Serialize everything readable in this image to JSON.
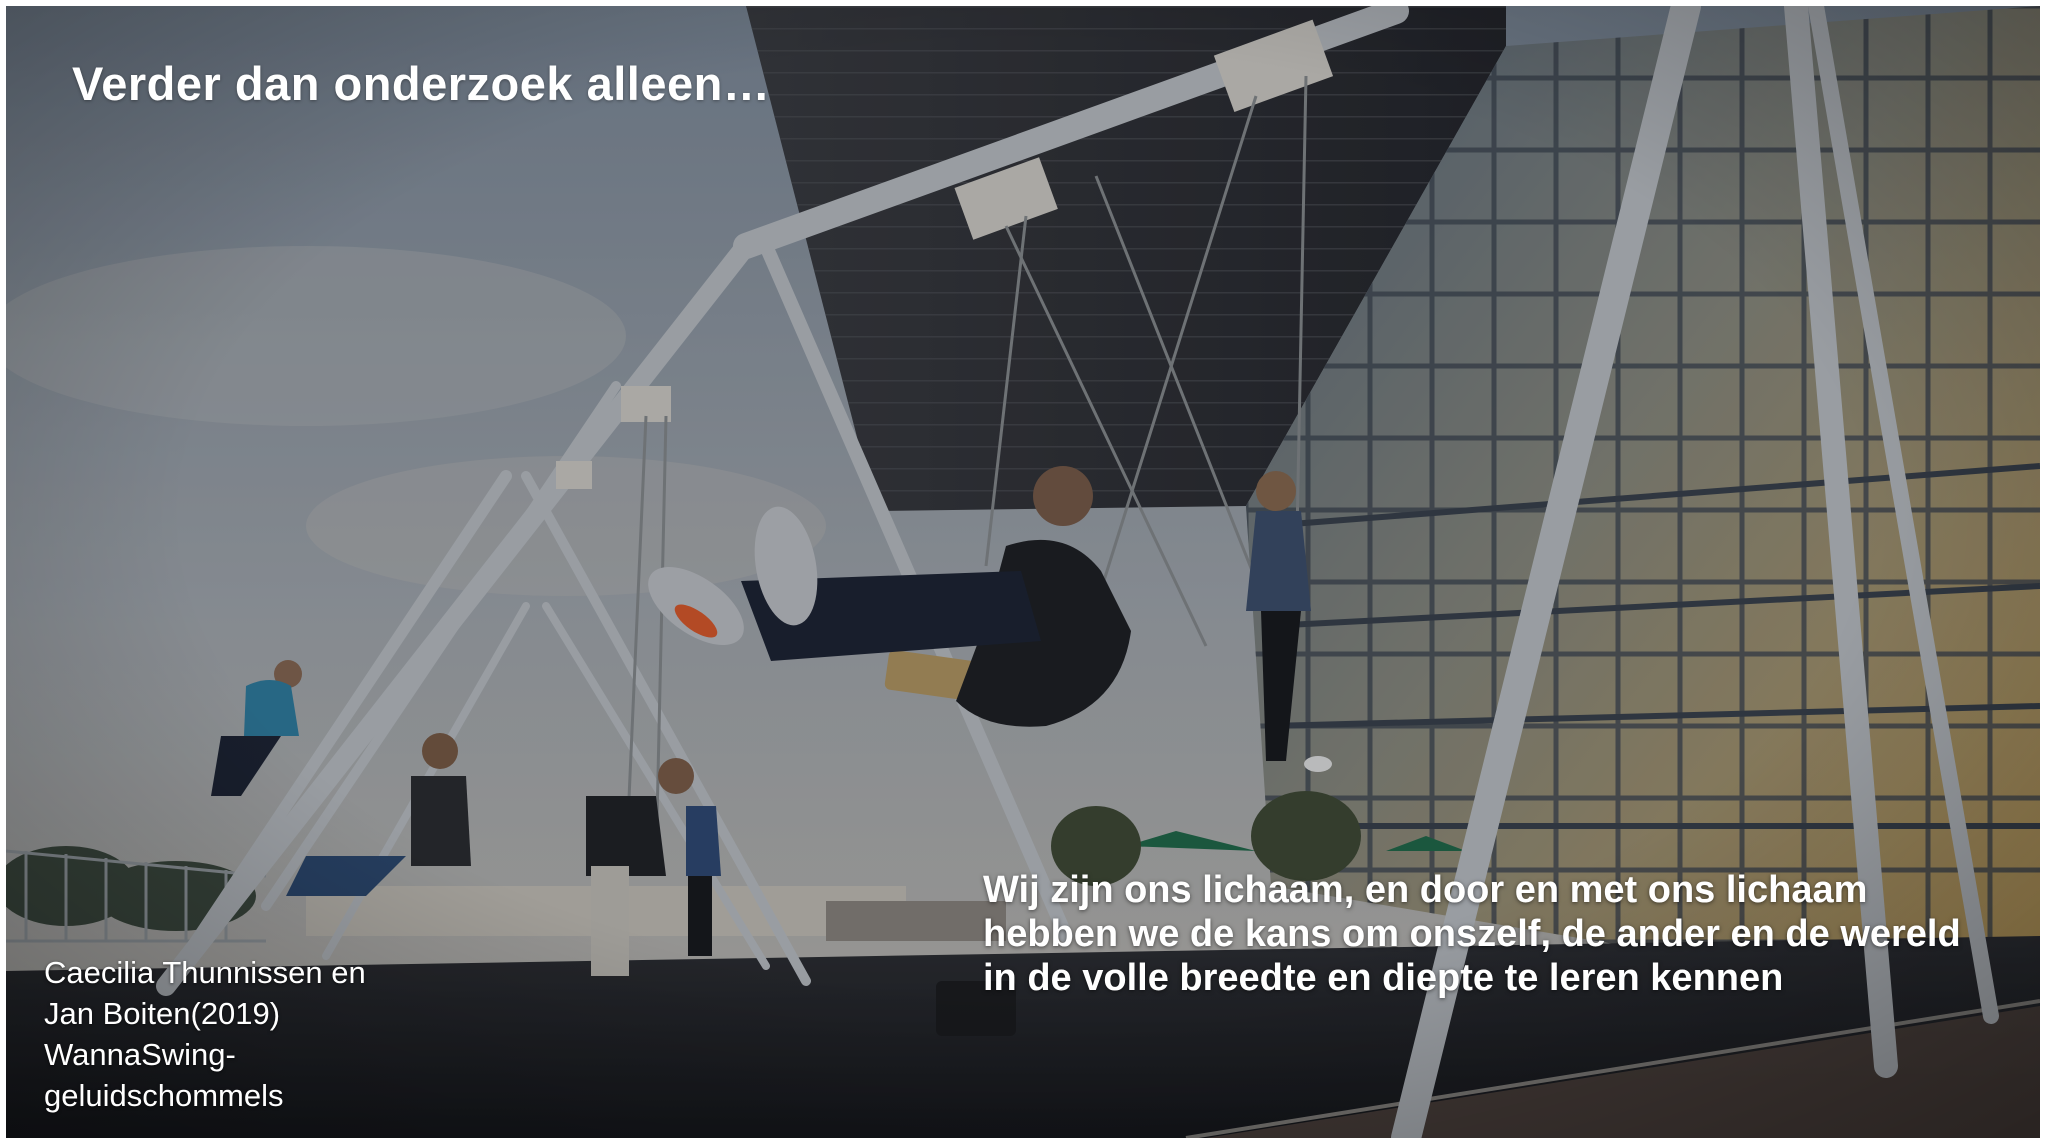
{
  "slide": {
    "title": "Verder dan onderzoek alleen…",
    "photo_credit": [
      "Caecilia Thunnissen en",
      "Jan Boiten(2019)",
      "WannaSwing-",
      "geluidschommels"
    ],
    "quote": "Wij zijn ons lichaam, en door en met ons lichaam hebben we de kans om onszelf, de ander en de wereld in de volle breedte en diepte te leren kennen"
  },
  "colors": {
    "title_text": "#ffffff",
    "sky_top": "#8a97a6",
    "sky_bottom": "#b9b6b0",
    "pavement": "#1c1d22",
    "steel": "#b4bac0",
    "roof_dark": "#34363c",
    "glass_warm": "#c9a45e"
  }
}
